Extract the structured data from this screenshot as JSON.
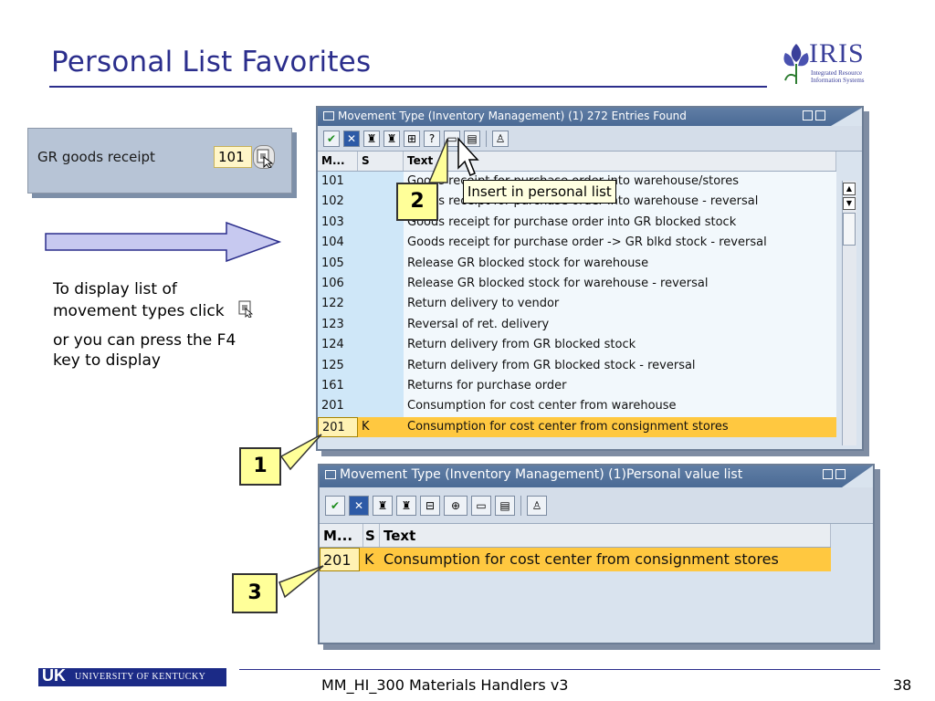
{
  "slide": {
    "title": "Personal List Favorites",
    "footer_text": "MM_HI_300 Materials Handlers v3",
    "page_number": "38"
  },
  "logo": {
    "iris": "IRIS",
    "line1": "Integrated Resource",
    "line2": "Information Systems"
  },
  "field": {
    "label": "GR goods receipt",
    "value": "101"
  },
  "instructions": {
    "p1": "To display list of movement types click",
    "p2": "or you can press the F4 key to display"
  },
  "window1": {
    "title": "Movement Type (Inventory Management) (1)  272 Entries Found",
    "headers": {
      "m": "M...",
      "s": "S",
      "text": "Text"
    },
    "rows": [
      {
        "m": "101",
        "s": "",
        "text": "Goods receipt for purchase order into warehouse/stores"
      },
      {
        "m": "102",
        "s": "",
        "text": "Goods receipt for purchase order into warehouse - reversal"
      },
      {
        "m": "103",
        "s": "",
        "text": "Goods receipt for purchase order into GR blocked stock"
      },
      {
        "m": "104",
        "s": "",
        "text": "Goods receipt for purchase order -> GR blkd stock - reversal"
      },
      {
        "m": "105",
        "s": "",
        "text": "Release GR blocked stock for warehouse"
      },
      {
        "m": "106",
        "s": "",
        "text": "Release GR blocked stock for warehouse - reversal"
      },
      {
        "m": "122",
        "s": "",
        "text": "Return delivery to vendor"
      },
      {
        "m": "123",
        "s": "",
        "text": "Reversal of ret. delivery"
      },
      {
        "m": "124",
        "s": "",
        "text": "Return delivery from GR blocked stock"
      },
      {
        "m": "125",
        "s": "",
        "text": "Return delivery from GR blocked stock - reversal"
      },
      {
        "m": "161",
        "s": "",
        "text": "Returns for purchase order"
      },
      {
        "m": "201",
        "s": "",
        "text": "Consumption for cost center from warehouse"
      },
      {
        "m": "201",
        "s": "K",
        "text": "Consumption for cost center from consignment stores"
      }
    ],
    "tooltip": "Insert in personal list"
  },
  "window2": {
    "title": "Movement Type (Inventory Management) (1)Personal value list",
    "headers": {
      "m": "M...",
      "s": "S",
      "text": "Text"
    },
    "rows": [
      {
        "m": "201",
        "s": "K",
        "text": "Consumption for cost center from consignment stores"
      }
    ]
  },
  "callouts": {
    "c1": "1",
    "c2": "2",
    "c3": "3"
  },
  "university": {
    "mark": "UK",
    "name": "UNIVERSITY OF KENTUCKY"
  },
  "colors": {
    "title": "#2b2e8c",
    "selected_row": "#ffc840",
    "callout": "#ffff99",
    "row_bg": "#cfe7f8"
  }
}
